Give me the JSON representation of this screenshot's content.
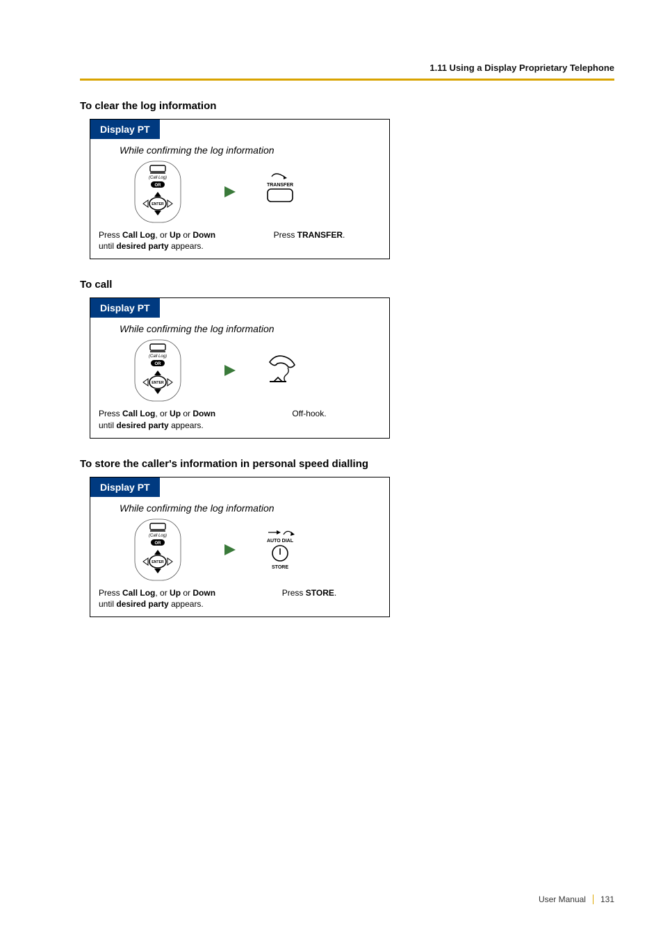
{
  "header": {
    "section": "1.11 Using a Display Proprietary Telephone"
  },
  "common": {
    "tab": "Display PT",
    "context": "While confirming the log information",
    "calllog_label": "(Call Log)",
    "or_label": "OR",
    "enter_label": "ENTER",
    "step1_caption_pre": "Press ",
    "step1_caption_b1": "Call Log",
    "step1_caption_mid1": ", or ",
    "step1_caption_b2": "Up",
    "step1_caption_mid2": " or ",
    "step1_caption_b3": "Down",
    "step1_caption_post": " until ",
    "step1_caption_b4": "desired party",
    "step1_caption_end": " appears."
  },
  "sections": [
    {
      "title": "To clear the log information",
      "action": {
        "label_top": "TRANSFER",
        "cap_pre": "Press ",
        "cap_b": "TRANSFER",
        "cap_post": "."
      }
    },
    {
      "title": "To call",
      "action": {
        "cap": "Off-hook."
      }
    },
    {
      "title": "To store the caller's information in personal speed dialling",
      "action": {
        "label_top": "AUTO DIAL",
        "label_bottom": "STORE",
        "cap_pre": "Press ",
        "cap_b": "STORE",
        "cap_post": "."
      }
    }
  ],
  "footer": {
    "label": "User Manual",
    "page": "131"
  }
}
